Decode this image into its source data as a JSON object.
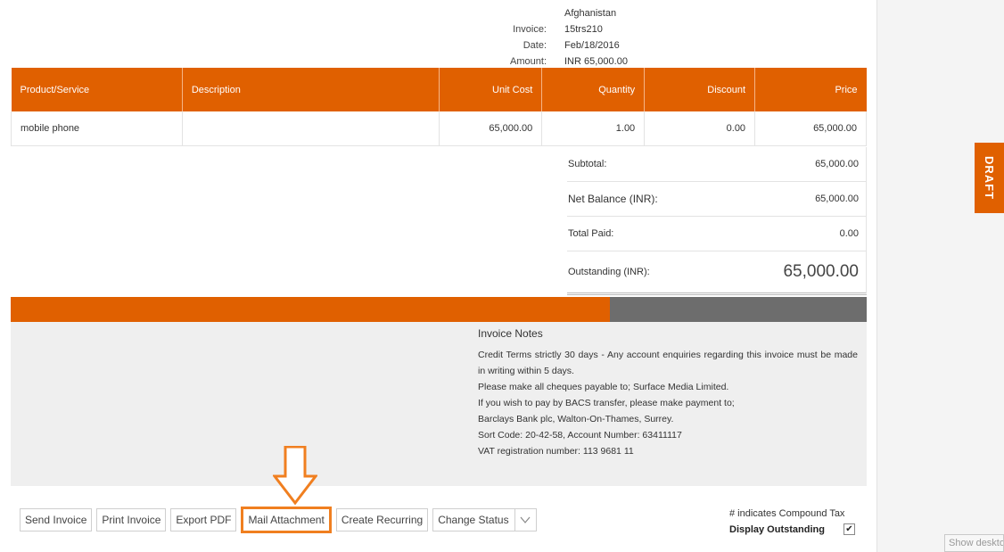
{
  "invoice_meta": {
    "country": "Afghanistan",
    "invoice_label": "Invoice:",
    "invoice_value": "15trs210",
    "date_label": "Date:",
    "date_value": "Feb/18/2016",
    "amount_label": "Amount:",
    "amount_value": "INR 65,000.00"
  },
  "items_table": {
    "headers": [
      "Product/Service",
      "Description",
      "Unit Cost",
      "Quantity",
      "Discount",
      "Price"
    ],
    "rows": [
      [
        "mobile phone",
        "",
        "65,000.00",
        "1.00",
        "0.00",
        "65,000.00"
      ]
    ]
  },
  "totals": {
    "subtotal_label": "Subtotal:",
    "subtotal_value": "65,000.00",
    "net_balance_label": "Net Balance (INR):",
    "net_balance_value": "65,000.00",
    "total_paid_label": "Total Paid:",
    "total_paid_value": "0.00",
    "outstanding_label": "Outstanding (INR):",
    "outstanding_value": "65,000.00"
  },
  "progress": {
    "fill_fraction": 0.7
  },
  "notes": {
    "title": "Invoice Notes",
    "lines": [
      "Credit Terms strictly 30 days - Any account enquiries regarding this invoice must be made in writing within 5 days.",
      "Please make all cheques payable to; Surface Media Limited.",
      "If you wish to pay by BACS transfer, please make payment to;",
      "Barclays Bank plc, Walton-On-Thames, Surrey.",
      "Sort Code: 20-42-58, Account Number: 63411117",
      "VAT registration number: 113 9681 11"
    ]
  },
  "actions": {
    "send_invoice": "Send Invoice",
    "print_invoice": "Print Invoice",
    "export_pdf": "Export PDF",
    "mail_attachment": "Mail Attachment",
    "create_recurring": "Create Recurring",
    "change_status": "Change Status"
  },
  "options": {
    "compound_tax_note": "# indicates Compound Tax",
    "display_outstanding_label": "Display Outstanding",
    "display_outstanding_checked": true
  },
  "side": {
    "draft_label": "DRAFT",
    "show_desktop": "Show desktop"
  },
  "colors": {
    "accent": "#e06000",
    "highlight": "#f07f20",
    "progress_track": "#6d6d6d"
  },
  "icons": {
    "arrow": "down-arrow-icon",
    "chevron": "chevron-down-icon",
    "checkbox": "checkmark-icon"
  }
}
